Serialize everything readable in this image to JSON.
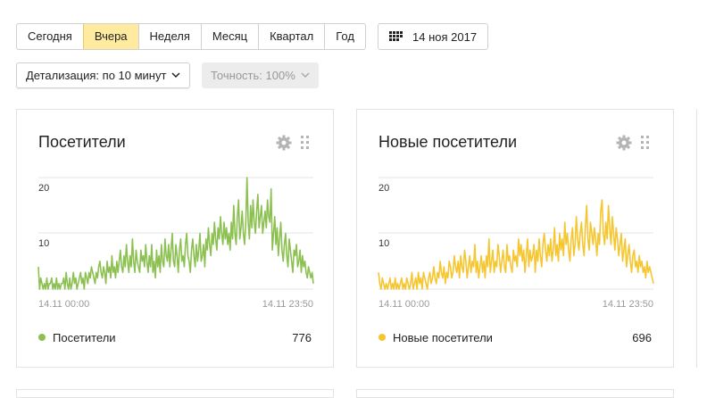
{
  "toolbar": {
    "periods": [
      {
        "label": "Сегодня",
        "active": false
      },
      {
        "label": "Вчера",
        "active": true
      },
      {
        "label": "Неделя",
        "active": false
      },
      {
        "label": "Месяц",
        "active": false
      },
      {
        "label": "Квартал",
        "active": false
      },
      {
        "label": "Год",
        "active": false
      }
    ],
    "date_label": "14 ноя 2017",
    "detail_label": "Детализация: по 10 минут",
    "accuracy_label": "Точность: 100%"
  },
  "widgets": [
    {
      "title": "Посетители",
      "legend_label": "Посетители",
      "total": "776",
      "x_start_label": "14.11 00:00",
      "x_end_label": "14.11 23:50",
      "y_ticks": [
        "20",
        "10"
      ],
      "color": "#8cc152"
    },
    {
      "title": "Новые посетители",
      "legend_label": "Новые посетители",
      "total": "696",
      "x_start_label": "14.11 00:00",
      "x_end_label": "14.11 23:50",
      "y_ticks": [
        "20",
        "10"
      ],
      "color": "#f6c630"
    }
  ],
  "chart_data": [
    {
      "type": "line",
      "title": "Посетители",
      "x_range": [
        "14.11 00:00",
        "14.11 23:50"
      ],
      "ylim": [
        0,
        20
      ],
      "series": [
        {
          "name": "Посетители",
          "values": [
            4,
            0,
            2,
            1,
            0,
            1,
            0,
            2,
            0,
            1,
            1,
            2,
            0,
            1,
            0,
            2,
            0,
            1,
            0,
            1,
            1,
            2,
            0,
            3,
            1,
            0,
            2,
            0,
            1,
            3,
            1,
            2,
            0,
            1,
            2,
            3,
            1,
            2,
            0,
            3,
            2,
            1,
            3,
            2,
            4,
            3,
            2,
            1,
            3,
            2,
            4,
            5,
            3,
            2,
            4,
            3,
            1,
            5,
            3,
            4,
            2,
            6,
            3,
            4,
            2,
            5,
            3,
            5,
            7,
            4,
            3,
            6,
            4,
            8,
            5,
            3,
            6,
            4,
            9,
            5,
            3,
            7,
            5,
            4,
            3,
            7,
            5,
            6,
            4,
            8,
            5,
            3,
            6,
            4,
            8,
            3,
            5,
            2,
            7,
            4,
            6,
            3,
            8,
            5,
            4,
            9,
            6,
            5,
            8,
            4,
            7,
            10,
            5,
            4,
            8,
            6,
            3,
            7,
            9,
            5,
            6,
            4,
            8,
            10,
            6,
            5,
            3,
            7,
            9,
            6,
            4,
            8,
            5,
            7,
            10,
            5,
            6,
            8,
            4,
            9,
            7,
            11,
            8,
            6,
            10,
            8,
            12,
            9,
            7,
            11,
            9,
            13,
            10,
            8,
            12,
            9,
            11,
            8,
            10,
            7,
            12,
            9,
            15,
            10,
            8,
            13,
            16,
            9,
            11,
            14,
            10,
            8,
            12,
            20,
            12,
            9,
            15,
            11,
            16,
            12,
            10,
            14,
            17,
            11,
            13,
            15,
            10,
            12,
            14,
            11,
            16,
            13,
            12,
            18,
            7,
            10,
            13,
            8,
            11,
            6,
            9,
            12,
            7,
            5,
            8,
            10,
            6,
            4,
            9,
            7,
            5,
            3,
            7,
            6,
            8,
            4,
            5,
            7,
            3,
            6,
            4,
            5,
            3,
            2,
            4,
            3,
            2,
            3,
            1
          ]
        }
      ]
    },
    {
      "type": "line",
      "title": "Новые посетители",
      "x_range": [
        "14.11 00:00",
        "14.11 23:50"
      ],
      "ylim": [
        0,
        20
      ],
      "series": [
        {
          "name": "Новые посетители",
          "values": [
            3,
            1,
            0,
            2,
            1,
            0,
            1,
            0,
            1,
            2,
            0,
            1,
            0,
            2,
            0,
            1,
            0,
            1,
            2,
            0,
            1,
            0,
            2,
            1,
            0,
            1,
            3,
            0,
            1,
            2,
            0,
            3,
            1,
            2,
            0,
            3,
            2,
            1,
            0,
            2,
            3,
            1,
            2,
            4,
            2,
            1,
            3,
            2,
            5,
            3,
            2,
            4,
            1,
            3,
            2,
            5,
            4,
            2,
            3,
            6,
            4,
            3,
            5,
            2,
            6,
            4,
            3,
            7,
            5,
            2,
            4,
            6,
            3,
            5,
            4,
            8,
            3,
            5,
            2,
            4,
            6,
            3,
            5,
            2,
            6,
            4,
            9,
            3,
            5,
            7,
            3,
            5,
            4,
            8,
            6,
            3,
            5,
            7,
            4,
            3,
            8,
            5,
            6,
            4,
            3,
            7,
            5,
            6,
            4,
            9,
            6,
            8,
            5,
            7,
            3,
            6,
            9,
            4,
            7,
            5,
            6,
            8,
            3,
            7,
            5,
            9,
            6,
            4,
            8,
            10,
            7,
            5,
            8,
            6,
            9,
            5,
            7,
            11,
            6,
            8,
            5,
            10,
            7,
            9,
            6,
            12,
            8,
            10,
            7,
            5,
            9,
            11,
            6,
            8,
            13,
            9,
            7,
            10,
            12,
            8,
            6,
            11,
            15,
            9,
            7,
            12,
            10,
            8,
            11,
            9,
            6,
            10,
            8,
            14,
            16,
            10,
            8,
            12,
            9,
            15,
            11,
            8,
            13,
            10,
            7,
            11,
            9,
            6,
            8,
            10,
            5,
            7,
            9,
            4,
            6,
            8,
            5,
            3,
            6,
            7,
            4,
            5,
            3,
            6,
            4,
            5,
            3,
            4,
            2,
            5,
            3,
            4,
            3,
            2,
            1
          ]
        }
      ]
    }
  ]
}
